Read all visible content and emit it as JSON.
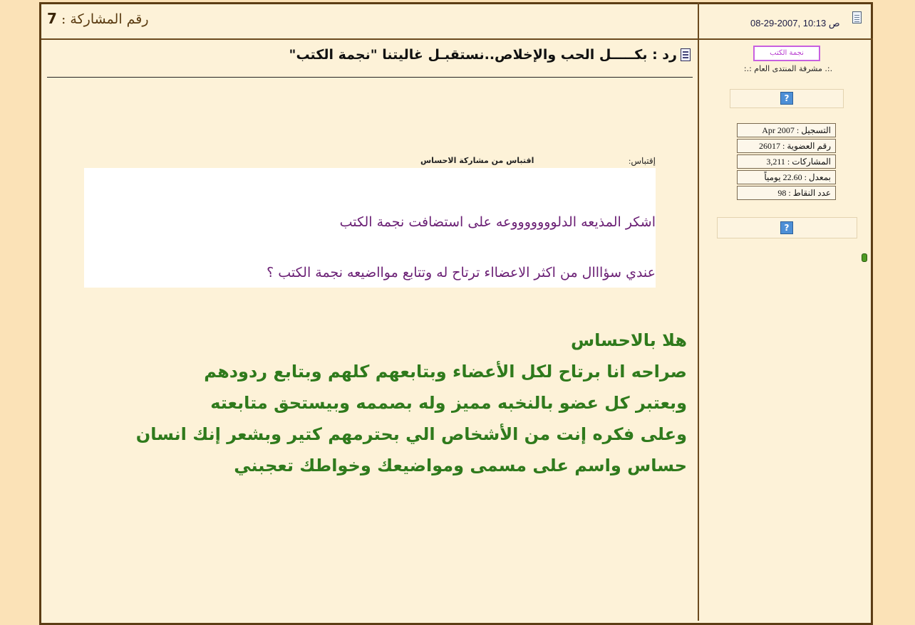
{
  "header": {
    "post_number_label": "رقم المشاركة :",
    "post_number": "7",
    "date": "08-29-2007, 10:13 ص"
  },
  "post": {
    "title": "رد : بكـــــل الحب والإخلاص..نستقبـل غاليتنا \"نجمة الكتب\"",
    "quote": {
      "label": "إقتباس:",
      "author": "اقتباس من مشاركة الاحساس",
      "lines": [
        "اشكر المذيعه الدلوووووووعه على استضافت نجمة الكتب",
        "عندي سؤااال من اكثر الاعضااء ترتاح له وتتابع موااضيعه نجمة الكتب ؟"
      ]
    },
    "reply_lines": [
      "هلا بالاحساس",
      "صراحه انا برتاح لكل الأعضاء وبتابعهم كلهم وبتابع ردودهم",
      "وبعتبر كل عضو بالنخبه مميز وله بصممه وبيستحق متابعته",
      "وعلى فكره إنت من الأشخاص الي بحترمهم كتير وبشعر إنك انسان",
      "حساس واسم على مسمى ومواضيعك وخواطك تعجبني"
    ]
  },
  "user": {
    "name": "نجمة الكتب",
    "title": ".:. مشرفة المنتدى العام :.:",
    "stats": [
      "التسجيل : Apr 2007",
      "رقم العضوية : 26017",
      "المشاركات : 3,211",
      "بمعدل : 22.60 يومياً",
      "عدد النقاط : 98"
    ],
    "avatar_icon": "question-mark-icon",
    "online_icon": "online-status-icon"
  },
  "colors": {
    "page_bg": "#fbe2b7",
    "panel_bg": "#fdf2d8",
    "border": "#5c3d14",
    "quote_text": "#6a1f74",
    "reply_text": "#2f7a1c",
    "username_border": "#c860e0"
  }
}
